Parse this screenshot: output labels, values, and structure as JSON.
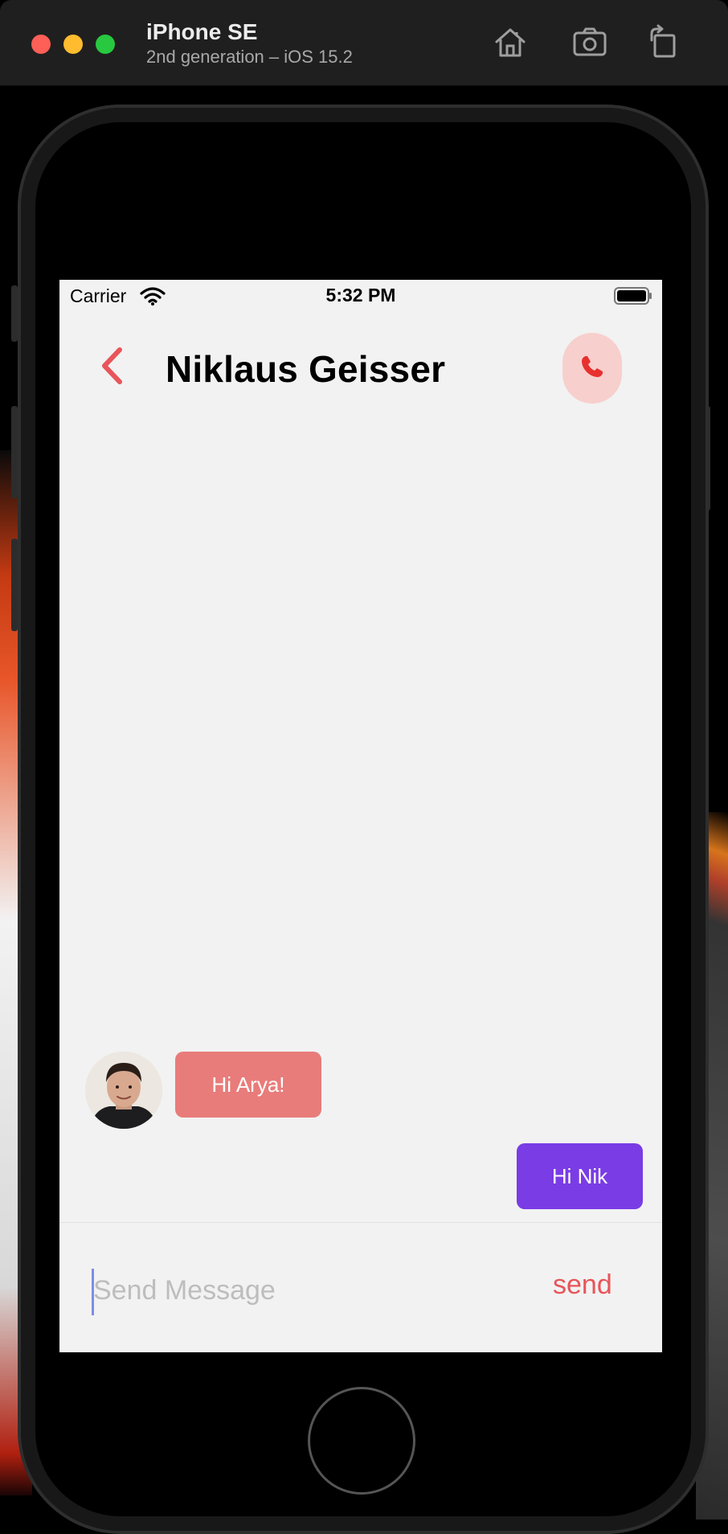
{
  "simulator": {
    "device_name": "iPhone SE",
    "os_label": "2nd generation – iOS 15.2",
    "toolbar": {
      "home_icon": "home-icon",
      "screenshot_icon": "camera-icon",
      "rotate_icon": "rotate-icon"
    }
  },
  "status_bar": {
    "carrier": "Carrier",
    "time": "5:32 PM"
  },
  "header": {
    "title": "Niklaus Geisser",
    "back_icon": "chevron-left-icon",
    "call_icon": "phone-icon"
  },
  "messages": [
    {
      "direction": "incoming",
      "text": "Hi Arya!"
    },
    {
      "direction": "outgoing",
      "text": "Hi Nik"
    }
  ],
  "composer": {
    "placeholder": "Send Message",
    "value": "",
    "send_label": "send"
  },
  "colors": {
    "accent": "#e8555a",
    "incoming_bubble": "#e87c7a",
    "outgoing_bubble": "#7a3ce5",
    "call_button_bg": "#f7cfcd",
    "screen_bg": "#f2f2f2"
  }
}
